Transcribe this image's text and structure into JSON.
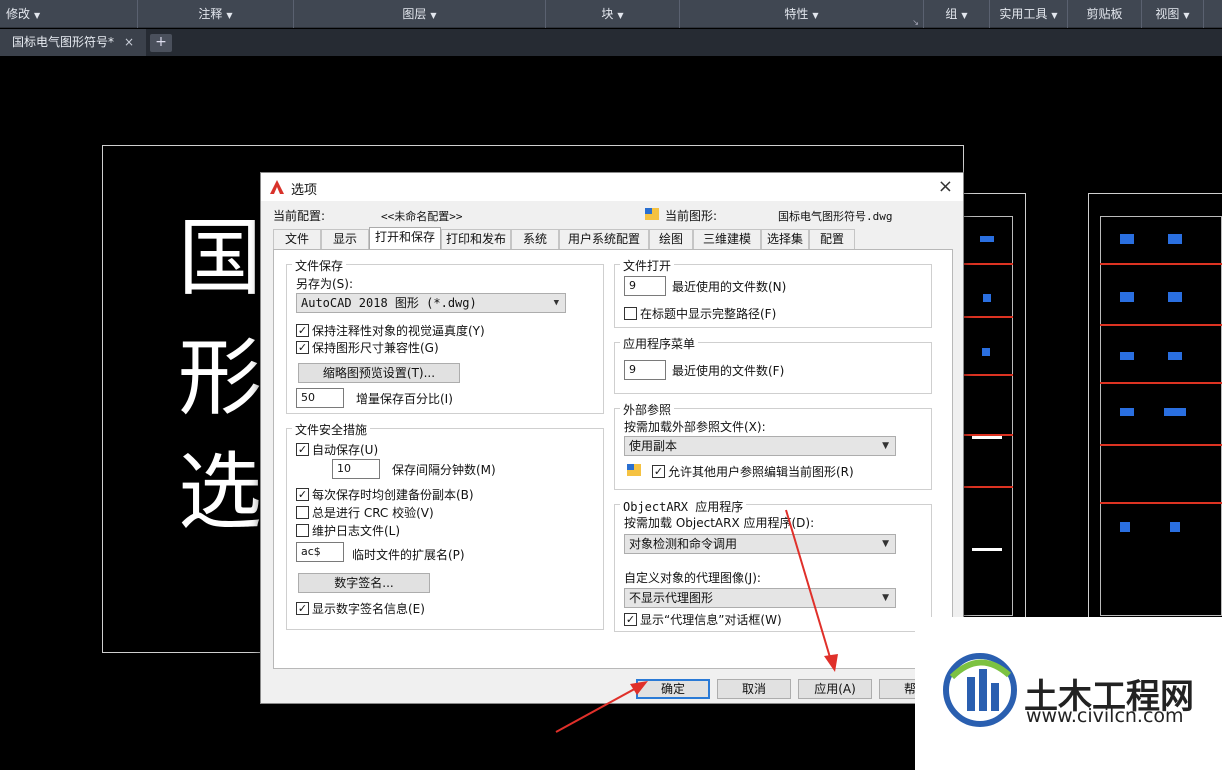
{
  "ribbon": {
    "panels": [
      {
        "label": "修改"
      },
      {
        "label": "注释"
      },
      {
        "label": "图层"
      },
      {
        "label": "块"
      },
      {
        "label": "特性"
      },
      {
        "label": "组"
      },
      {
        "label": "实用工具"
      },
      {
        "label": "剪贴板"
      },
      {
        "label": "视图"
      }
    ]
  },
  "doc_tab": {
    "label": "国标电气图形符号*",
    "close": "×",
    "add": "+"
  },
  "drawing": {
    "chars": [
      "国",
      "形",
      "选"
    ]
  },
  "dialog": {
    "title": "选项",
    "close": "×",
    "current_profile_label": "当前配置:",
    "current_profile_value": "<<未命名配置>>",
    "current_drawing_label": "当前图形:",
    "current_drawing_value": "国标电气图形符号.dwg",
    "tabs": [
      "文件",
      "显示",
      "打开和保存",
      "打印和发布",
      "系统",
      "用户系统配置",
      "绘图",
      "三维建模",
      "选择集",
      "配置"
    ],
    "file_save": {
      "title": "文件保存",
      "save_as_label": "另存为(S):",
      "save_as_value": "AutoCAD 2018 图形 (*.dwg)",
      "keep_annot": "保持注释性对象的视觉逼真度(Y)",
      "keep_compat": "保持图形尺寸兼容性(G)",
      "thumb_button": "缩略图预览设置(T)...",
      "incremental_value": "50",
      "incremental_label": "增量保存百分比(I)"
    },
    "file_safety": {
      "title": "文件安全措施",
      "autosave": "自动保存(U)",
      "interval_value": "10",
      "interval_label": "保存间隔分钟数(M)",
      "backup": "每次保存时均创建备份副本(B)",
      "crc": "总是进行 CRC 校验(V)",
      "log": "维护日志文件(L)",
      "ext_value": "ac$",
      "ext_label": "临时文件的扩展名(P)",
      "sig_button": "数字签名...",
      "show_sig": "显示数字签名信息(E)"
    },
    "file_open": {
      "title": "文件打开",
      "recent_value": "9",
      "recent_label": "最近使用的文件数(N)",
      "full_path": "在标题中显示完整路径(F)"
    },
    "app_menu": {
      "title": "应用程序菜单",
      "recent_value": "9",
      "recent_label": "最近使用的文件数(F)"
    },
    "xref": {
      "title": "外部参照",
      "load_label": "按需加载外部参照文件(X):",
      "load_value": "使用副本",
      "allow_edit": "允许其他用户参照编辑当前图形(R)"
    },
    "arx": {
      "title": "ObjectARX 应用程序",
      "load_label": "按需加载 ObjectARX 应用程序(D):",
      "load_value": "对象检测和命令调用",
      "proxy_label": "自定义对象的代理图像(J):",
      "proxy_value": "不显示代理图形",
      "show_proxy": "显示“代理信息”对话框(W)"
    },
    "buttons": {
      "ok": "确定",
      "cancel": "取消",
      "apply": "应用(A)",
      "help": "帮助"
    }
  },
  "watermark": {
    "title": "土木工程网",
    "url": "www.civilcn.com"
  },
  "colors": {
    "accent": "#2a7ad6",
    "annotation_arrow": "#e0302a"
  }
}
